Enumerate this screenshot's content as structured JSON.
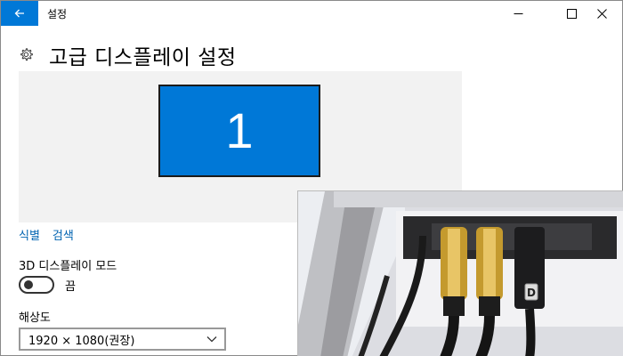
{
  "window": {
    "title": "설정",
    "controls": {
      "minimize": "minimize-icon",
      "maximize": "maximize-icon",
      "close": "close-icon"
    }
  },
  "header": {
    "icon": "gear-icon",
    "title": "고급 디스플레이 설정"
  },
  "preview": {
    "monitors": [
      {
        "label": "1",
        "selected": true
      }
    ],
    "colors": {
      "monitor": "#0078d7",
      "background": "#f2f2f2"
    }
  },
  "links": {
    "identify": "식별",
    "detect": "검색"
  },
  "mode3d": {
    "label": "3D 디스플레이 모드",
    "toggle_state": "끔",
    "enabled": false
  },
  "resolution": {
    "label": "해상도",
    "selected": "1920 × 1080(권장)"
  },
  "photo": {
    "visible_text": "D"
  },
  "theme": {
    "accent": "#0078d7",
    "link": "#0063b1"
  }
}
